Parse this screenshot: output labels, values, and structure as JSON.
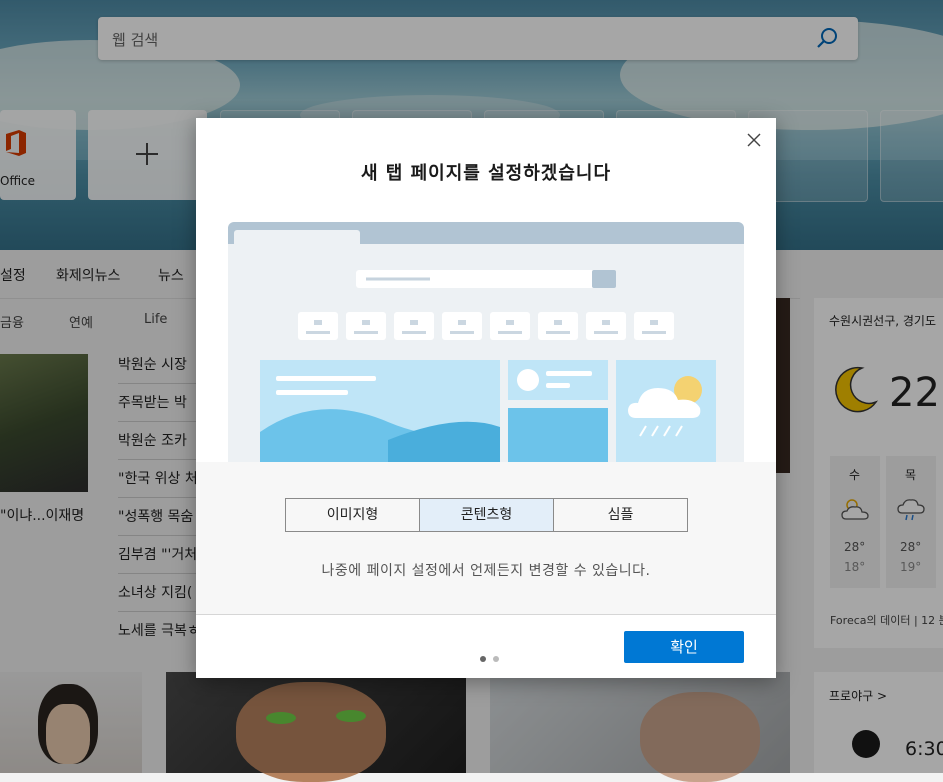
{
  "search": {
    "placeholder": "웹 검색"
  },
  "tiles": {
    "office_label": "Office"
  },
  "nav": {
    "items": [
      "설정",
      "화제의뉴스",
      "뉴스"
    ]
  },
  "subnav": {
    "items": [
      "금융",
      "연예",
      "Life"
    ]
  },
  "news": {
    "caption": "\"이냐...이재명",
    "headlines": [
      "박원순 시장",
      "주목받는 박",
      "박원순 조카",
      "\"한국 위상 처",
      "\"성폭행 목숨",
      "김부겸 \"'거처",
      "소녀상 지킴(",
      "노세를 극복ㅎ"
    ]
  },
  "weather": {
    "location": "수원시권선구, 경기도",
    "temp": "22",
    "days": [
      {
        "day": "수",
        "high": "28°",
        "low": "18°"
      },
      {
        "day": "목",
        "high": "28°",
        "low": "19°"
      }
    ],
    "source": "Foreca의 데이터 | 12 분"
  },
  "baseball": {
    "title": "프로야구 >",
    "time": "6:30"
  },
  "modal": {
    "title": "새 탭 페이지를 설정하겠습니다",
    "layouts": [
      "이미지형",
      "콘텐츠형",
      "심플"
    ],
    "selected": "콘텐츠형",
    "hint": "나중에 페이지 설정에서 언제든지 변경할 수 있습니다.",
    "confirm": "확인"
  },
  "colors": {
    "accent": "#0078d4",
    "selected_segment": "#e3eef9",
    "illus_blue": "#6cc3ea"
  }
}
